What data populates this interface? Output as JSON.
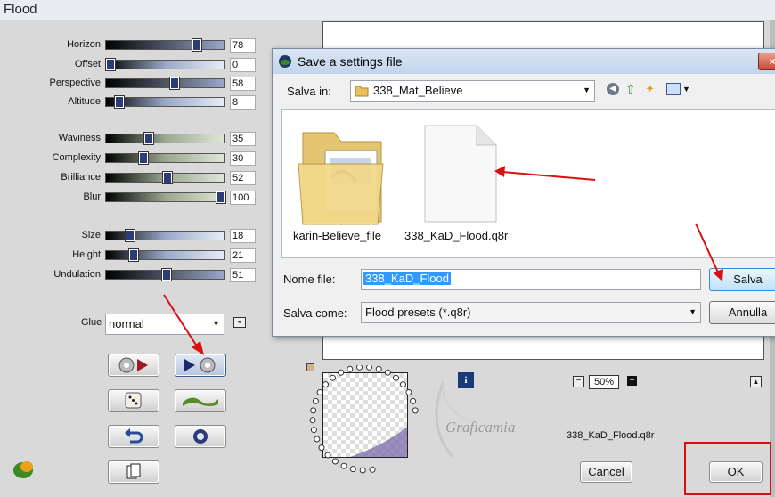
{
  "window": {
    "title": "Flood"
  },
  "sliders": [
    {
      "label": "Horizon",
      "value": "78",
      "fill": 0.78,
      "gradient": "linear-gradient(90deg,#000,#9aa8c8)"
    },
    {
      "label": "Offset",
      "value": "0",
      "fill": 0.0,
      "gradient": "linear-gradient(90deg,#000,#9aa8c8,#e8eef8)"
    },
    {
      "label": "Perspective",
      "value": "58",
      "fill": 0.58,
      "gradient": "linear-gradient(90deg,#000,#9aa8c8)"
    },
    {
      "label": "Altitude",
      "value": "8",
      "fill": 0.08,
      "gradient": "linear-gradient(90deg,#000,#9aa8c8,#e8eef8)"
    },
    {
      "label": "Waviness",
      "value": "35",
      "fill": 0.35,
      "gradient": "linear-gradient(90deg,#000,#9aa890,#e0e6d6)"
    },
    {
      "label": "Complexity",
      "value": "30",
      "fill": 0.3,
      "gradient": "linear-gradient(90deg,#000,#9aa890,#e0e6d6)"
    },
    {
      "label": "Brilliance",
      "value": "52",
      "fill": 0.52,
      "gradient": "linear-gradient(90deg,#000,#9aa890,#e0e6d6)"
    },
    {
      "label": "Blur",
      "value": "100",
      "fill": 1.0,
      "gradient": "linear-gradient(90deg,#000,#9aa890,#e0e6d6)"
    },
    {
      "label": "Size",
      "value": "18",
      "fill": 0.18,
      "gradient": "linear-gradient(90deg,#000,#9aa8c8,#e8eef8)"
    },
    {
      "label": "Height",
      "value": "21",
      "fill": 0.21,
      "gradient": "linear-gradient(90deg,#000,#9aa8c8,#e8eef8)"
    },
    {
      "label": "Undulation",
      "value": "51",
      "fill": 0.51,
      "gradient": "linear-gradient(90deg,#000,#9aa8c8)"
    }
  ],
  "glue": {
    "label": "Glue",
    "value": "normal"
  },
  "zoom": "50%",
  "filename_label": "338_KaD_Flood.q8r",
  "buttons": {
    "cancel": "Cancel",
    "ok": "OK"
  },
  "watermark": "Graficamia",
  "dialog": {
    "title": "Save a settings file",
    "save_in_label": "Salva in:",
    "save_in_value": "338_Mat_Believe",
    "files": [
      {
        "name": "karin-Believe_file",
        "type": "folder"
      },
      {
        "name": "338_KaD_Flood.q8r",
        "type": "file"
      }
    ],
    "filename_label": "Nome file:",
    "filename_value": "338_KaD_Flood",
    "savetype_label": "Salva come:",
    "savetype_value": "Flood presets (*.q8r)",
    "save_button": "Salva",
    "cancel_button": "Annulla"
  },
  "colors": {
    "accent_red": "#d81010",
    "selection": "#3399ff"
  }
}
